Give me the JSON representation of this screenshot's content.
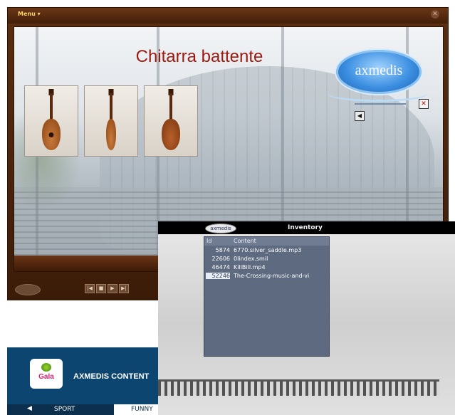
{
  "player": {
    "menu_label": "Menu ▾",
    "close_glyph": "✕",
    "stage_title": "Chitarra battente",
    "logo_text": "axmedis",
    "icons": {
      "speaker": "speaker-icon",
      "mute": "mute-icon"
    },
    "speaker_glyph": "◀",
    "mute_glyph": "✕",
    "controls": [
      "|◀",
      "■",
      "▶",
      "▶|"
    ]
  },
  "inventory": {
    "logo_text": "axmedis",
    "title": "Inventory",
    "columns": {
      "id": "Id",
      "content": "Content"
    },
    "rows": [
      {
        "id": "5874",
        "content": "6770.silver_saddle.mp3"
      },
      {
        "id": "22606",
        "content": "0Iindex.smil"
      },
      {
        "id": "46474",
        "content": "KillBill.mp4"
      },
      {
        "id": "52246",
        "content": "The-Crossing-music-and-vi"
      }
    ]
  },
  "gala": {
    "logo_text": "Gala",
    "title": "AXMEDIS CONTENT",
    "arrow": "◀",
    "tabs": {
      "sport": "SPORT",
      "funny": "FUNNY"
    }
  },
  "colors": {
    "player_frame": "#5a2e12",
    "stage_title": "#9b1a10",
    "logo_blue": "#3a8de0",
    "inventory_panel": "#5d6a80",
    "gala_bg": "#0b4570"
  }
}
